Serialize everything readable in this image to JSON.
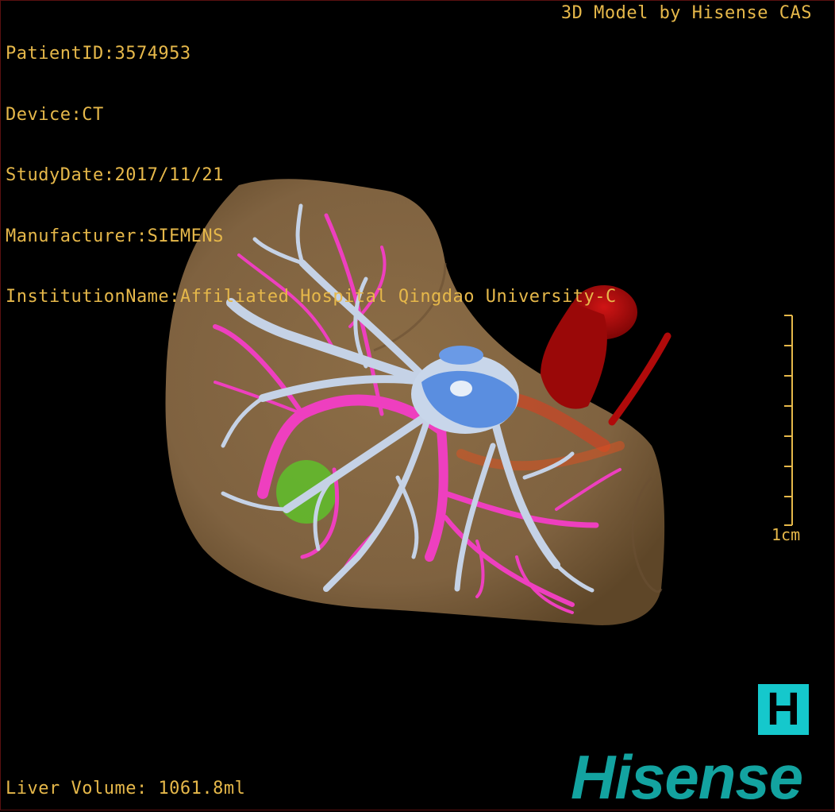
{
  "overlay": {
    "patient_id": "PatientID:3574953",
    "device": "Device:CT",
    "study_date": "StudyDate:2017/11/21",
    "manufacturer": "Manufacturer:SIEMENS",
    "institution": "InstitutionName:Affiliated Hospital Qingdao University-C",
    "credit": "3D Model by Hisense CAS",
    "liver_volume": "Liver Volume: 1061.8ml",
    "scale_label": "1cm"
  },
  "logo": {
    "mark": "H",
    "brand": "Hisense"
  },
  "colors": {
    "overlay_text": "#e6b84a",
    "liver": "#8a6a42",
    "portal_vein": "#c5d2e6",
    "hepatic_vein": "#ee3fbf",
    "artery": "#b50a0a",
    "tumor": "#5fbf2a",
    "brand": "#13a3a0"
  }
}
